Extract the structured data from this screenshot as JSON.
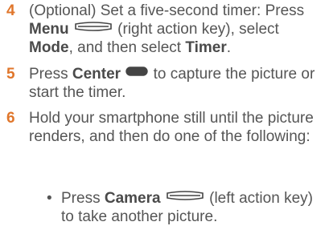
{
  "steps": [
    {
      "number": "4",
      "lead": "(Optional) Set a five-second timer: Press ",
      "key1_label": "Menu",
      "key1_icon": "right-action-key-icon",
      "after_key1": " (right action key), select ",
      "mode_label": "Mode",
      "mid": ", and then select ",
      "timer_label": "Timer",
      "end": "."
    },
    {
      "number": "5",
      "lead": "Press ",
      "key_label": "Center",
      "key_icon": "center-key-icon",
      "rest": " to capture the picture or start the timer."
    },
    {
      "number": "6",
      "text": "Hold your smartphone still until the picture renders, and then do one of the following:"
    }
  ],
  "bullets": [
    {
      "symbol": "•",
      "lead": "Press ",
      "key_label": "Camera",
      "key_icon": "left-action-key-icon",
      "rest": " (left action key) to take another picture."
    }
  ],
  "colors": {
    "step_number": "#e0762b",
    "body_text": "#555555"
  }
}
